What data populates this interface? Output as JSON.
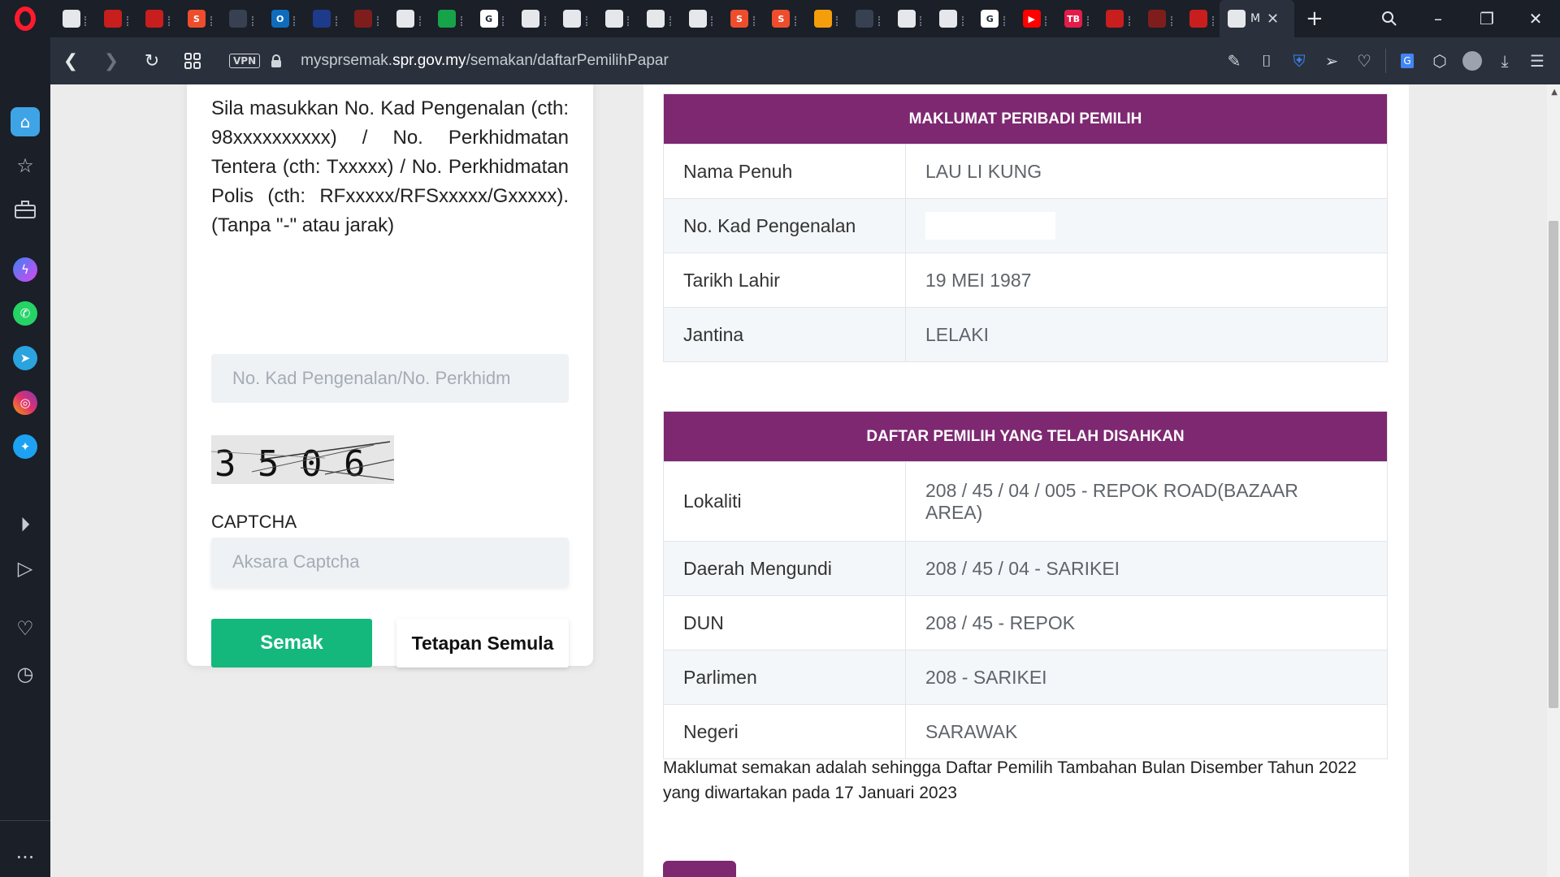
{
  "browser": {
    "tabs": [
      {
        "name": "tab-doc",
        "color": "#e5e7eb",
        "glyph": ""
      },
      {
        "name": "tab-cartoon-1",
        "color": "#c81e1e",
        "glyph": ""
      },
      {
        "name": "tab-cartoon-2",
        "color": "#c81e1e",
        "glyph": ""
      },
      {
        "name": "tab-shopee-1",
        "color": "#ee4d2d",
        "glyph": "S"
      },
      {
        "name": "tab-camera",
        "color": "#374151",
        "glyph": ""
      },
      {
        "name": "tab-outlook",
        "color": "#0f6cbd",
        "glyph": "O"
      },
      {
        "name": "tab-tool",
        "color": "#1e3a8a",
        "glyph": ""
      },
      {
        "name": "tab-opera-1",
        "color": "#7f1d1d",
        "glyph": ""
      },
      {
        "name": "tab-globe-1",
        "color": "#e5e7eb",
        "glyph": ""
      },
      {
        "name": "tab-emblem",
        "color": "#16a34a",
        "glyph": ""
      },
      {
        "name": "tab-google-1",
        "color": "#ffffff",
        "glyph": "G"
      },
      {
        "name": "tab-globe-2",
        "color": "#e5e7eb",
        "glyph": ""
      },
      {
        "name": "tab-globe-3",
        "color": "#e5e7eb",
        "glyph": ""
      },
      {
        "name": "tab-globe-4",
        "color": "#e5e7eb",
        "glyph": ""
      },
      {
        "name": "tab-globe-5",
        "color": "#e5e7eb",
        "glyph": ""
      },
      {
        "name": "tab-globe-6",
        "color": "#e5e7eb",
        "glyph": ""
      },
      {
        "name": "tab-shopee-2",
        "color": "#ee4d2d",
        "glyph": "S"
      },
      {
        "name": "tab-shopee-3",
        "color": "#ee4d2d",
        "glyph": "S"
      },
      {
        "name": "tab-grid",
        "color": "#f59e0b",
        "glyph": ""
      },
      {
        "name": "tab-speed",
        "color": "#374151",
        "glyph": ""
      },
      {
        "name": "tab-swirl-1",
        "color": "#e5e7eb",
        "glyph": ""
      },
      {
        "name": "tab-swirl-2",
        "color": "#e5e7eb",
        "glyph": ""
      },
      {
        "name": "tab-google-2",
        "color": "#ffffff",
        "glyph": "G"
      },
      {
        "name": "tab-youtube",
        "color": "#ff0000",
        "glyph": "▶"
      },
      {
        "name": "tab-tb",
        "color": "#e11d48",
        "glyph": "TB"
      },
      {
        "name": "tab-cartoon-3",
        "color": "#c81e1e",
        "glyph": ""
      },
      {
        "name": "tab-opera-2",
        "color": "#7f1d1d",
        "glyph": ""
      },
      {
        "name": "tab-cartoon-4",
        "color": "#c81e1e",
        "glyph": ""
      }
    ],
    "active_tab_title": "M",
    "url_host_prefix": "mysprsemak.",
    "url_host": "spr.gov.my",
    "url_path": "/semakan/daftarPemilihPapar",
    "vpn_label": "VPN"
  },
  "form": {
    "instructions": "Sila masukkan No. Kad Pengenalan (cth: 98xxxxxxxxxx) / No. Perkhidmatan Tentera (cth: Txxxxx) / No. Perkhidmatan Polis (cth: RFxxxxx/RFSxxxxx/Gxxxxx). (Tanpa \"-\" atau jarak)",
    "ic_placeholder": "No. Kad Pengenalan/No. Perkhidm",
    "captcha_text": "3506",
    "captcha_label": "CAPTCHA",
    "captcha_placeholder": "Aksara Captcha",
    "submit_label": "Semak",
    "reset_label": "Tetapan Semula"
  },
  "voter_info": {
    "title": "MAKLUMAT PERIBADI PEMILIH",
    "rows": [
      {
        "label": "Nama Penuh",
        "value": "LAU LI KUNG"
      },
      {
        "label": "No. Kad Pengenalan",
        "value": ""
      },
      {
        "label": "Tarikh Lahir",
        "value": "19 MEI 1987"
      },
      {
        "label": "Jantina",
        "value": "LELAKI"
      }
    ]
  },
  "register_info": {
    "title": "DAFTAR PEMILIH YANG TELAH DISAHKAN",
    "rows": [
      {
        "label": "Lokaliti",
        "value": "208 / 45 / 04 / 005 - REPOK ROAD(BAZAAR AREA)"
      },
      {
        "label": "Daerah Mengundi",
        "value": "208 / 45 / 04 - SARIKEI"
      },
      {
        "label": "DUN",
        "value": "208 / 45 - REPOK"
      },
      {
        "label": "Parlimen",
        "value": "208 - SARIKEI"
      },
      {
        "label": "Negeri",
        "value": "SARAWAK"
      }
    ]
  },
  "note": "Maklumat semakan adalah sehingga Daftar Pemilih Tambahan Bulan Disember Tahun 2022 yang diwartakan pada 17 Januari 2023",
  "colors": {
    "header_purple": "#7d2871",
    "submit_green": "#14b87d",
    "opera_red": "#ff1b2d"
  }
}
